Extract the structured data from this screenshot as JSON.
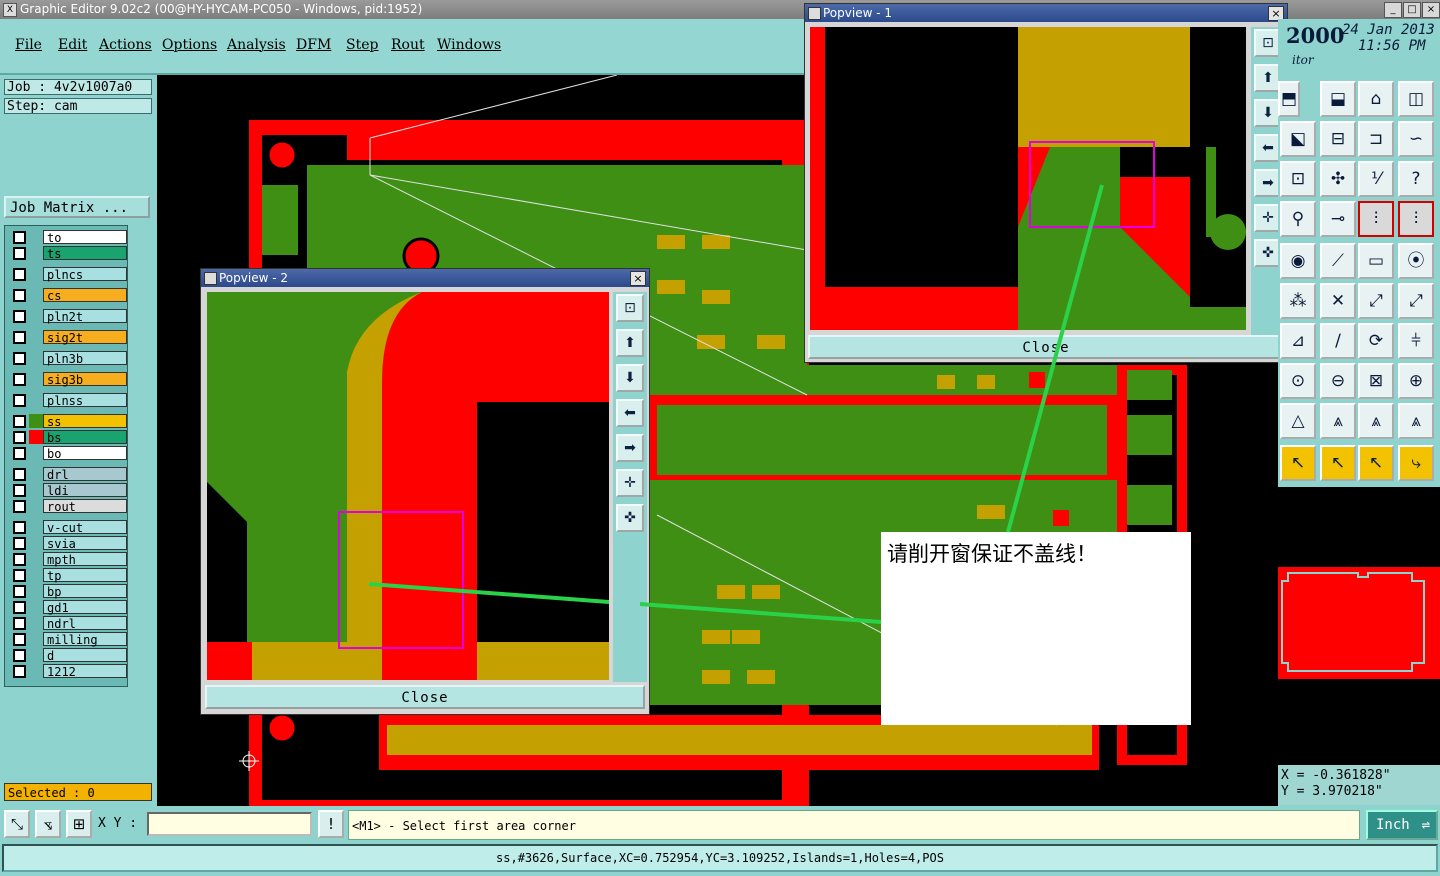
{
  "window": {
    "title": "Graphic Editor 9.02c2 (00@HY-HYCAM-PC050 - Windows, pid:1952)",
    "app_icon": "app-icon",
    "controls": [
      "_",
      "□",
      "×"
    ]
  },
  "menubar": [
    "File",
    "Edit",
    "Actions",
    "Options",
    "Analysis",
    "DFM",
    "Step",
    "Rout",
    "Windows"
  ],
  "job": {
    "job_label": "Job : 4v2v1007a0",
    "step_label": "Step: cam",
    "matrix_button": "Job Matrix ..."
  },
  "layers": [
    {
      "name": "to",
      "color": "#ffffff"
    },
    {
      "name": "ts",
      "color": "#19a36f"
    },
    {
      "name": "plncs",
      "color": "#a8dfe0"
    },
    {
      "name": "cs",
      "color": "#f6ae1e"
    },
    {
      "name": "pln2t",
      "color": "#a8dfe0"
    },
    {
      "name": "sig2t",
      "color": "#f6ae1e"
    },
    {
      "name": "pln3b",
      "color": "#a8dfe0"
    },
    {
      "name": "sig3b",
      "color": "#f6ae1e"
    },
    {
      "name": "plnss",
      "color": "#a8dfe0"
    },
    {
      "name": "ss",
      "color": "#f2c200"
    },
    {
      "name": "bs",
      "color": "#19a36f"
    },
    {
      "name": "bo",
      "color": "#ffffff"
    },
    {
      "name": "drl",
      "color": "#a8c8cf"
    },
    {
      "name": "ldi",
      "color": "#a8c8cf"
    },
    {
      "name": "rout",
      "color": "#dcdcdc"
    },
    {
      "name": "v-cut",
      "color": "#a8dfe0"
    },
    {
      "name": "svia",
      "color": "#a8dfe0"
    },
    {
      "name": "mpth",
      "color": "#a8dfe0"
    },
    {
      "name": "tp",
      "color": "#a8dfe0"
    },
    {
      "name": "bp",
      "color": "#a8dfe0"
    },
    {
      "name": "gd1",
      "color": "#a8dfe0"
    },
    {
      "name": "ndrl",
      "color": "#a8dfe0"
    },
    {
      "name": "milling",
      "color": "#a8dfe0"
    },
    {
      "name": "d",
      "color": "#a8dfe0"
    },
    {
      "name": "1212",
      "color": "#a8dfe0"
    }
  ],
  "selected_label": "Selected : 0",
  "popview1": {
    "title": "Popview - 1",
    "close_label": "Close"
  },
  "popview2": {
    "title": "Popview - 2",
    "close_label": "Close"
  },
  "annotation_note": "请削开窗保证不盖线！",
  "date_panel": {
    "year_fragment": "2000",
    "date": "24 Jan 2013",
    "time": "11:56 PM",
    "subtitle_fragment": "itor"
  },
  "coords": {
    "x": "X = -0.361828\"",
    "y": "Y = 3.970218\""
  },
  "bottom": {
    "xy_label": "X Y :",
    "info_button": "!",
    "prompt": "<M1> - Select first area corner",
    "unit": "Inch",
    "status": "ss,#3626,Surface,XC=0.752954,YC=3.109252,Islands=1,Holes=4,POS"
  },
  "colors": {
    "copper_red": "#ff0000",
    "soldermask_green": "#3f8f14",
    "pad_gold": "#c4a000",
    "panel_teal": "#8fd3cf",
    "highlight_magenta": "#e000e0",
    "pointer_green": "#2ad24a"
  }
}
